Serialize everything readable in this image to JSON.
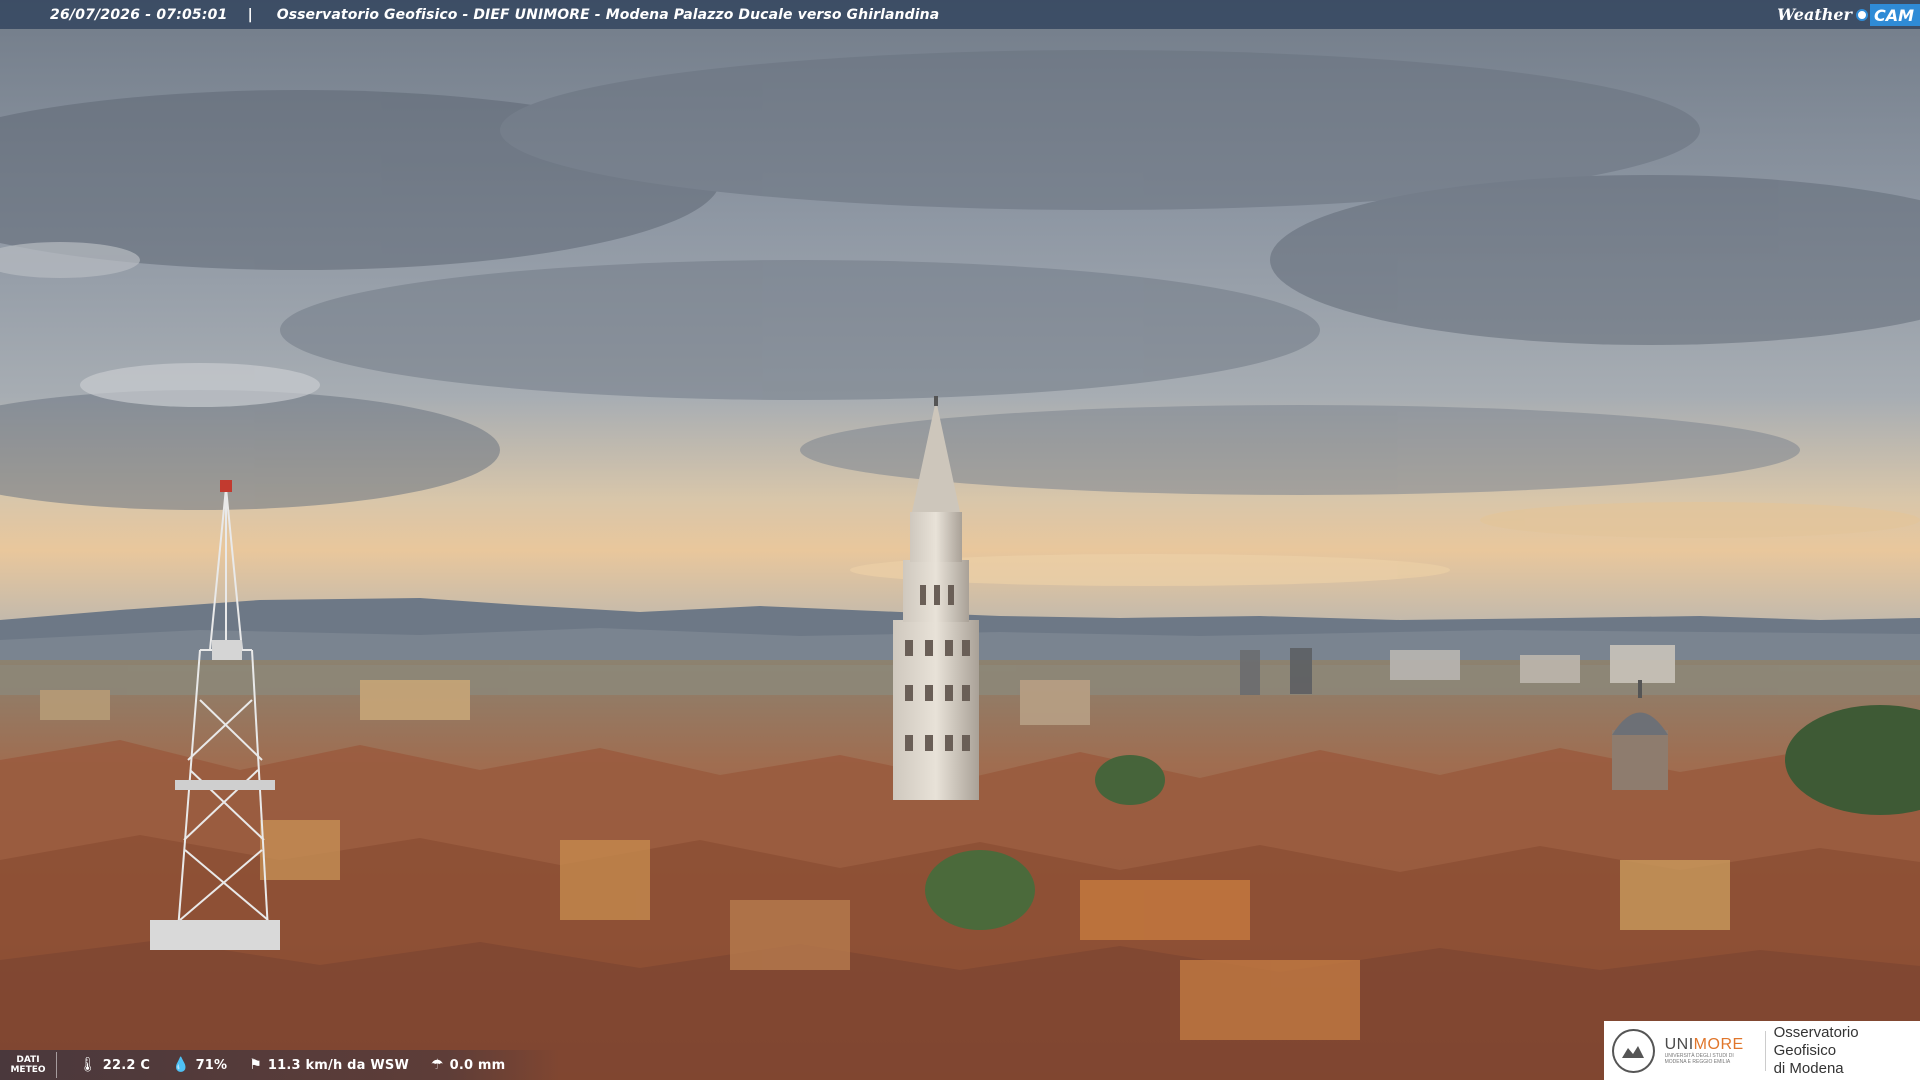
{
  "overlay": {
    "timestamp": "26/07/2026 - 07:05:01",
    "separator": "|",
    "caption": "Osservatorio Geofisico - DIEF UNIMORE - Modena Palazzo Ducale verso Ghirlandina",
    "brand_weather": "Weather",
    "brand_cam": "CAM"
  },
  "weather": {
    "label_line1": "DATI",
    "label_line2": "METEO",
    "temperature": "22.2 C",
    "humidity": "71%",
    "wind": "11.3 km/h da WSW",
    "rain": "0.0 mm",
    "icons": [
      "thermometer-icon",
      "humidity-drop-icon",
      "wind-icon",
      "rain-icon"
    ]
  },
  "logo": {
    "uni_prefix": "UNI",
    "uni_accent": "MORE",
    "uni_sub": "UNIVERSITÀ DEGLI STUDI DI MODENA E REGGIO EMILIA",
    "observatory_line1": "Osservatorio Geofisico",
    "observatory_line2": "di Modena",
    "accent_color": "#e0762b"
  },
  "colors": {
    "sky_top": "#7c8592",
    "horizon_glow": "#e8c79a",
    "rooftops": "#a4674a",
    "topbar": "#283c58",
    "brand_blue": "#2f8bd6"
  }
}
